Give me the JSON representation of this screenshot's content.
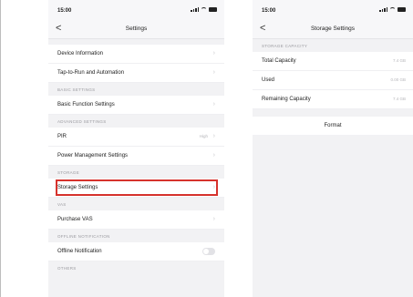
{
  "left": {
    "status": {
      "time": "15:00"
    },
    "nav": {
      "back": "<",
      "title": "Settings"
    },
    "rows": {
      "device_info": "Device Information",
      "tap_to_run": "Tap-to-Run and Automation",
      "basic_settings_header": "BASIC SETTINGS",
      "basic_function": "Basic Function Settings",
      "advanced_settings_header": "ADVANCED SETTINGS",
      "pir": "PIR",
      "pir_value": "High",
      "power_management": "Power Management Settings",
      "storage_header": "STORAGE",
      "storage_settings": "Storage Settings",
      "vas_header": "VAS",
      "purchase_vas": "Purchase VAS",
      "offline_header": "OFFLINE NOTIFICATION",
      "offline_notification": "Offline Notification",
      "others_header": "OTHERS"
    }
  },
  "right": {
    "status": {
      "time": "15:00"
    },
    "nav": {
      "back": "<",
      "title": "Storage Settings"
    },
    "storage_capacity_header": "STORAGE CAPACITY",
    "total_capacity": {
      "label": "Total Capacity",
      "value": "7.4 GB"
    },
    "used": {
      "label": "Used",
      "value": "0.00 GB"
    },
    "remaining_capacity": {
      "label": "Remaining Capacity",
      "value": "7.4 GB"
    },
    "format_label": "Format"
  }
}
